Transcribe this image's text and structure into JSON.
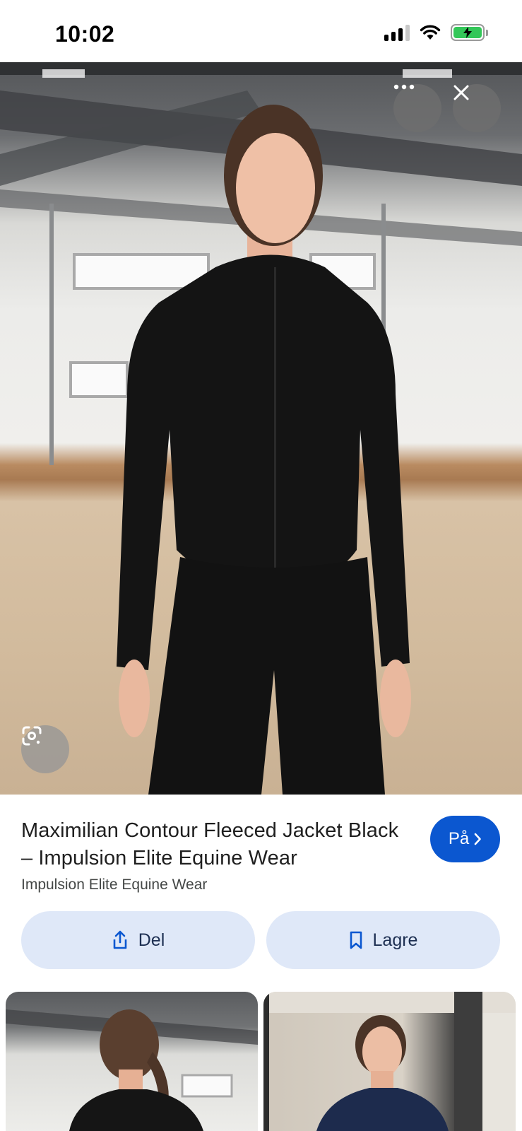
{
  "status_bar": {
    "time": "10:02",
    "icons": [
      "cellular-signal-icon",
      "wifi-icon",
      "battery-charging-icon"
    ]
  },
  "hero_image": {
    "alt": "Maximilian Contour Fleeced Jacket Black",
    "more_icon": "more-horizontal-icon",
    "close_icon": "close-icon",
    "lens_icon": "google-lens-icon"
  },
  "result": {
    "title": "Maximilian Contour Fleeced Jacket Black – Impulsion Elite Equine Wear",
    "source": "Impulsion Elite Equine Wear",
    "visit_label": "På"
  },
  "actions": {
    "share_label": "Del",
    "save_label": "Lagre"
  },
  "colors": {
    "accent": "#0b57d0",
    "action_bg": "#dfe8f8",
    "overlay_button": "#6e6e6e"
  }
}
